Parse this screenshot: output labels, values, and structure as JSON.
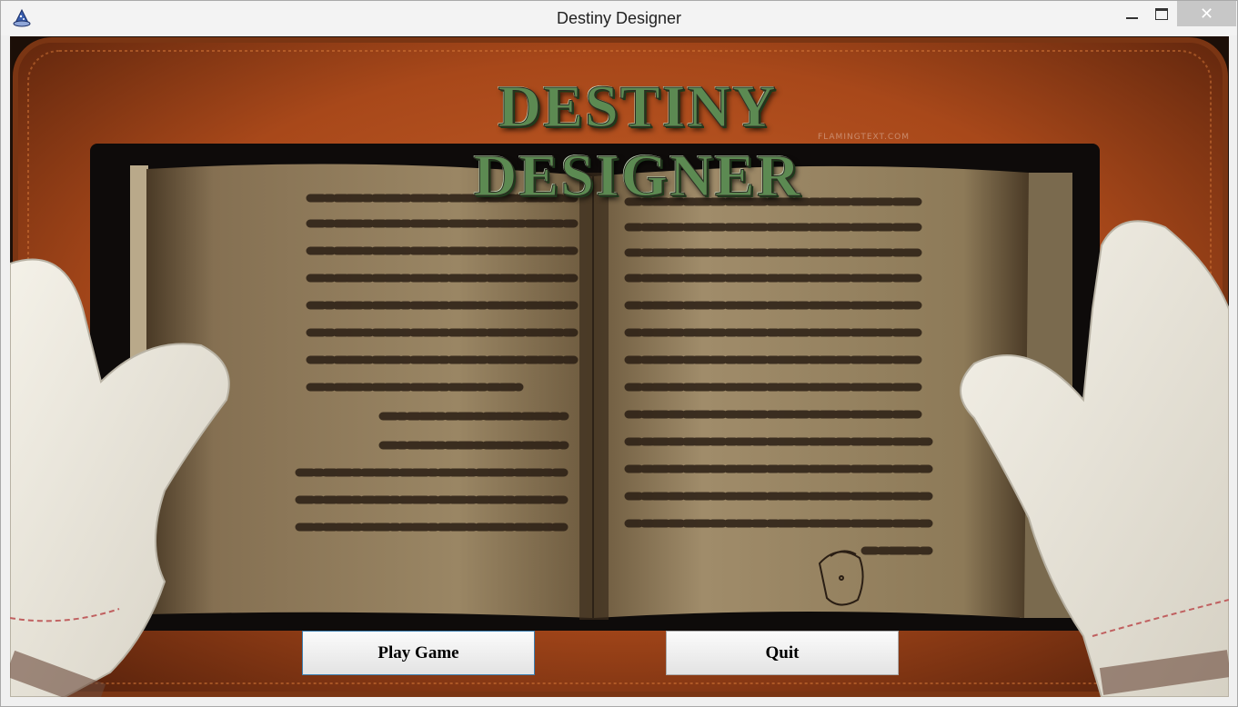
{
  "window": {
    "title": "Destiny Designer",
    "controls": {
      "minimize": "minimize",
      "maximize": "maximize",
      "close": "✕"
    }
  },
  "splash": {
    "logo_text": "DESTINY DESIGNER",
    "watermark": "FLAMINGTEXT.COM"
  },
  "menu": {
    "play_label": "Play Game",
    "quit_label": "Quit"
  },
  "icons": {
    "app": "wizard-hat-icon",
    "minimize": "minimize-icon",
    "maximize": "maximize-icon",
    "close": "close-icon"
  },
  "colors": {
    "titlebar": "#f3f3f3",
    "close_button": "#c7c7c7",
    "cushion": "#b5521d",
    "parchment": "#8c7a58",
    "logo_green": "#5c8a52",
    "focus_border": "#3c7fb1"
  }
}
